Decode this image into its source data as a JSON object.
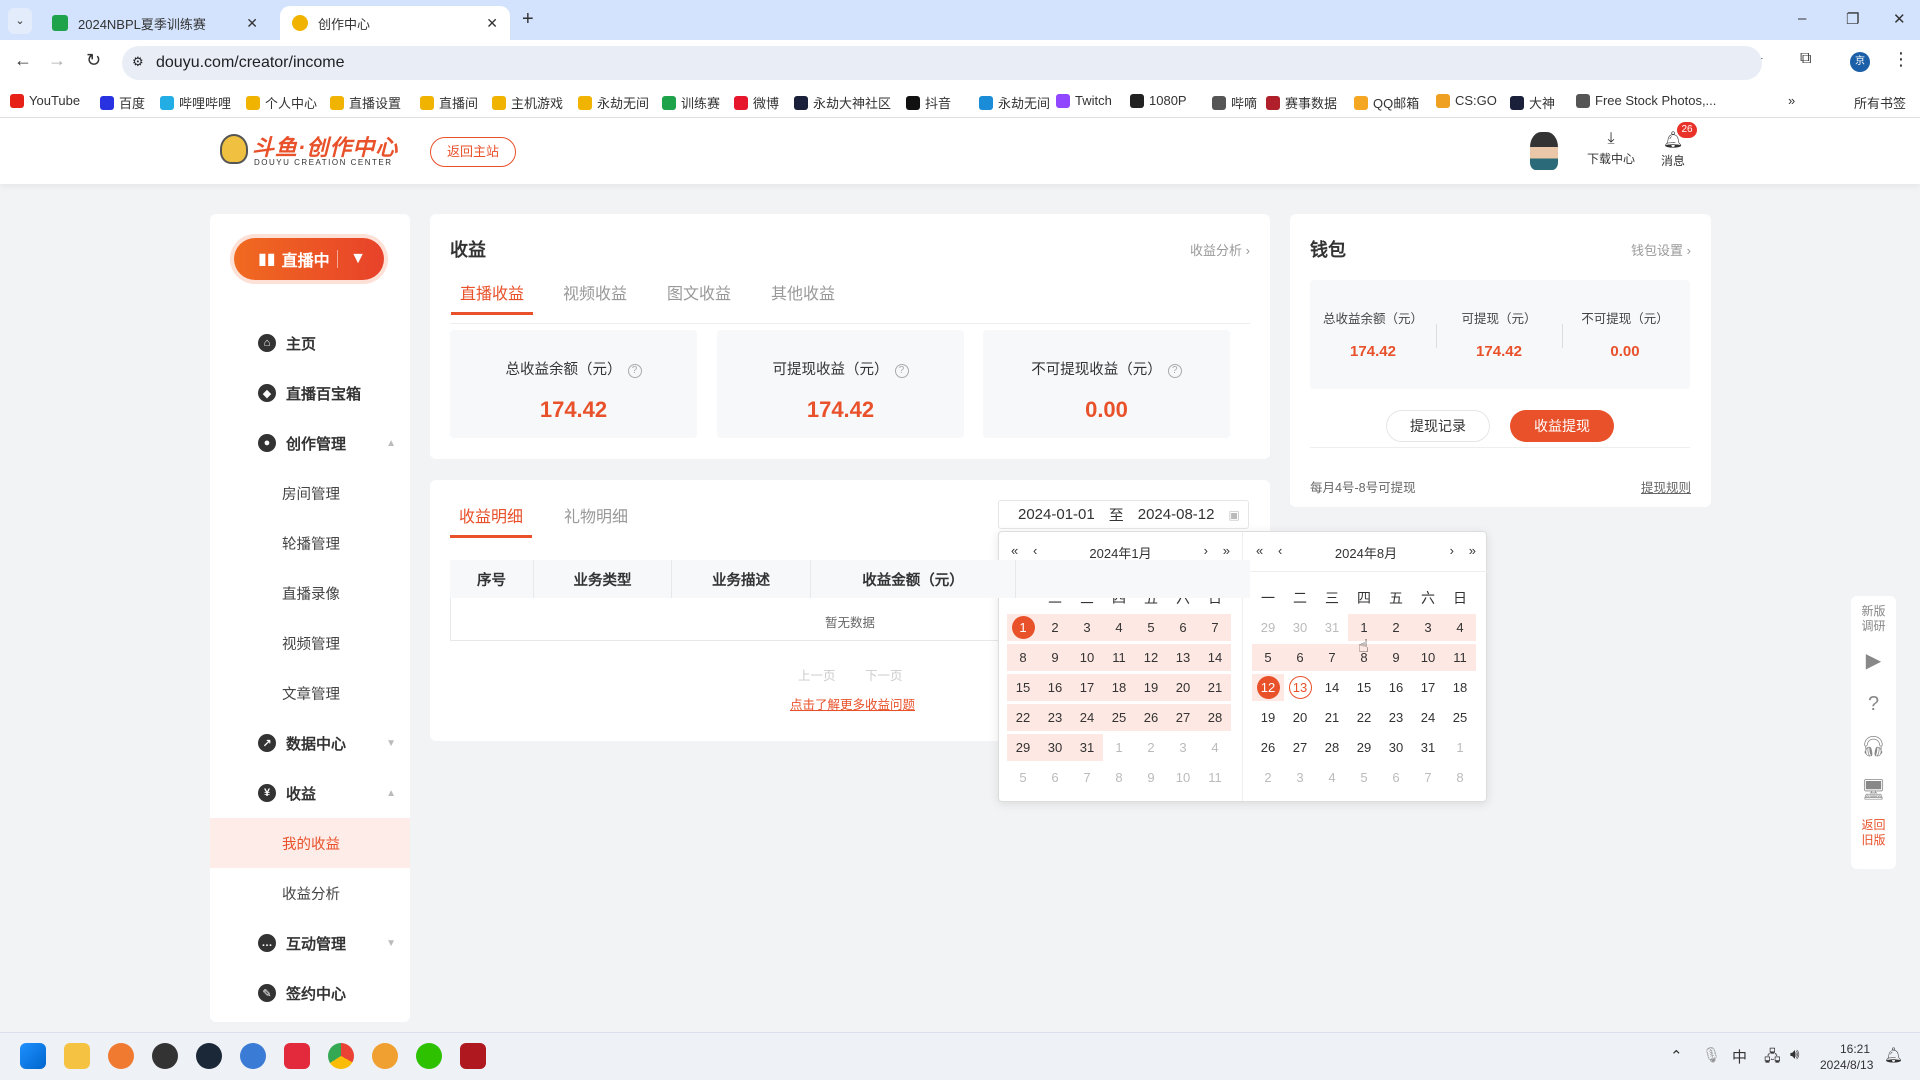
{
  "browser": {
    "tabs": [
      {
        "title": "2024NBPL夏季训练赛",
        "favicon_color": "#1fa34a",
        "active": false
      },
      {
        "title": "创作中心",
        "favicon_color": "#f0b400",
        "active": true
      }
    ],
    "new_tab": "+",
    "url": "douyu.com/creator/income",
    "bookmarks": [
      {
        "label": "YouTube",
        "color": "#e62117"
      },
      {
        "label": "百度",
        "color": "#2932e1"
      },
      {
        "label": "哔哩哔哩",
        "color": "#23ade5"
      },
      {
        "label": "个人中心",
        "color": "#f0b400"
      },
      {
        "label": "直播设置",
        "color": "#f0b400"
      },
      {
        "label": "直播间",
        "color": "#f0b400"
      },
      {
        "label": "主机游戏",
        "color": "#f0b400"
      },
      {
        "label": "永劫无间",
        "color": "#f0b400"
      },
      {
        "label": "训练赛",
        "color": "#1fa34a"
      },
      {
        "label": "微博",
        "color": "#e6162d"
      },
      {
        "label": "永劫大神社区",
        "color": "#1a1f3a"
      },
      {
        "label": "抖音",
        "color": "#111"
      },
      {
        "label": "永劫无间",
        "color": "#1a8cd8"
      },
      {
        "label": "Twitch",
        "color": "#9146ff"
      },
      {
        "label": "1080P",
        "color": "#222"
      },
      {
        "label": "哔嘀",
        "color": "#555"
      },
      {
        "label": "赛事数据",
        "color": "#b0202a"
      },
      {
        "label": "QQ邮箱",
        "color": "#f5a623"
      },
      {
        "label": "CS:GO",
        "color": "#f0a020"
      },
      {
        "label": "大神",
        "color": "#1a1f3a"
      },
      {
        "label": "Free Stock Photos,...",
        "color": "#555"
      }
    ],
    "more": "»",
    "all_bookmarks": "所有书签",
    "profile_initial": "京"
  },
  "header": {
    "logo_text": "斗鱼·创作中心",
    "logo_sub": "DOUYU CREATION CENTER",
    "back_button": "返回主站",
    "download": "下载中心",
    "messages": "消息",
    "message_count": "26"
  },
  "sidebar": {
    "live_button": "直播中",
    "items": [
      {
        "label": "主页",
        "type": "main",
        "icon": "home-icon"
      },
      {
        "label": "直播百宝箱",
        "type": "main",
        "icon": "box-icon"
      },
      {
        "label": "创作管理",
        "type": "main",
        "icon": "bulb-icon",
        "caret": "up"
      },
      {
        "label": "房间管理",
        "type": "sub"
      },
      {
        "label": "轮播管理",
        "type": "sub"
      },
      {
        "label": "直播录像",
        "type": "sub"
      },
      {
        "label": "视频管理",
        "type": "sub"
      },
      {
        "label": "文章管理",
        "type": "sub"
      },
      {
        "label": "数据中心",
        "type": "main",
        "icon": "chart-icon",
        "caret": "down"
      },
      {
        "label": "收益",
        "type": "main",
        "icon": "yuan-icon",
        "caret": "up"
      },
      {
        "label": "我的收益",
        "type": "sub",
        "active": true
      },
      {
        "label": "收益分析",
        "type": "sub"
      },
      {
        "label": "互动管理",
        "type": "main",
        "icon": "chat-icon",
        "caret": "down"
      },
      {
        "label": "签约中心",
        "type": "main",
        "icon": "sign-icon"
      }
    ]
  },
  "income": {
    "title": "收益",
    "analysis_link": "收益分析",
    "tabs": [
      "直播收益",
      "视频收益",
      "图文收益",
      "其他收益"
    ],
    "active_tab": 0,
    "stats": [
      {
        "label": "总收益余额（元）",
        "value": "174.42"
      },
      {
        "label": "可提现收益（元）",
        "value": "174.42"
      },
      {
        "label": "不可提现收益（元）",
        "value": "0.00"
      }
    ]
  },
  "wallet": {
    "title": "钱包",
    "settings_link": "钱包设置",
    "stats": [
      {
        "label": "总收益余额（元）",
        "value": "174.42"
      },
      {
        "label": "可提现（元）",
        "value": "174.42"
      },
      {
        "label": "不可提现（元）",
        "value": "0.00"
      }
    ],
    "record_button": "提现记录",
    "withdraw_button": "收益提现",
    "note": "每月4号-8号可提现",
    "rules_link": "提现规则"
  },
  "details": {
    "tabs": [
      "收益明细",
      "礼物明细"
    ],
    "active_tab": 0,
    "date_start": "2024-01-01",
    "date_sep": "至",
    "date_end": "2024-08-12",
    "columns": [
      "序号",
      "业务类型",
      "业务描述",
      "收益金额（元）"
    ],
    "empty": "暂无数据",
    "prev": "上一页",
    "next": "下一页",
    "help_link": "点击了解更多收益问题"
  },
  "calendar": {
    "weekdays": [
      "一",
      "二",
      "三",
      "四",
      "五",
      "六",
      "日"
    ],
    "panels": [
      {
        "title": "2024年1月",
        "days": [
          [
            1,
            "sel"
          ],
          [
            2,
            "range"
          ],
          [
            3,
            "range"
          ],
          [
            4,
            "range"
          ],
          [
            5,
            "range"
          ],
          [
            6,
            "range"
          ],
          [
            7,
            "range"
          ],
          [
            8,
            "range"
          ],
          [
            9,
            "range"
          ],
          [
            10,
            "range"
          ],
          [
            11,
            "range"
          ],
          [
            12,
            "range"
          ],
          [
            13,
            "range"
          ],
          [
            14,
            "range"
          ],
          [
            15,
            "range"
          ],
          [
            16,
            "range"
          ],
          [
            17,
            "range"
          ],
          [
            18,
            "range"
          ],
          [
            19,
            "range"
          ],
          [
            20,
            "range"
          ],
          [
            21,
            "range"
          ],
          [
            22,
            "range"
          ],
          [
            23,
            "range"
          ],
          [
            24,
            "range"
          ],
          [
            25,
            "range"
          ],
          [
            26,
            "range"
          ],
          [
            27,
            "range"
          ],
          [
            28,
            "range"
          ],
          [
            29,
            "range"
          ],
          [
            30,
            "range"
          ],
          [
            31,
            "range"
          ],
          [
            1,
            "other"
          ],
          [
            2,
            "other"
          ],
          [
            3,
            "other"
          ],
          [
            4,
            "other"
          ],
          [
            5,
            "other"
          ],
          [
            6,
            "other"
          ],
          [
            7,
            "other"
          ],
          [
            8,
            "other"
          ],
          [
            9,
            "other"
          ],
          [
            10,
            "other"
          ],
          [
            11,
            "other"
          ]
        ]
      },
      {
        "title": "2024年8月",
        "days": [
          [
            29,
            "other"
          ],
          [
            30,
            "other"
          ],
          [
            31,
            "other"
          ],
          [
            1,
            "range"
          ],
          [
            2,
            "range"
          ],
          [
            3,
            "range"
          ],
          [
            4,
            "range"
          ],
          [
            5,
            "range"
          ],
          [
            6,
            "range"
          ],
          [
            7,
            "range"
          ],
          [
            8,
            "range"
          ],
          [
            9,
            "range"
          ],
          [
            10,
            "range"
          ],
          [
            11,
            "range"
          ],
          [
            12,
            "sel"
          ],
          [
            13,
            "today"
          ],
          [
            14,
            ""
          ],
          [
            15,
            ""
          ],
          [
            16,
            ""
          ],
          [
            17,
            ""
          ],
          [
            18,
            ""
          ],
          [
            19,
            ""
          ],
          [
            20,
            ""
          ],
          [
            21,
            ""
          ],
          [
            22,
            ""
          ],
          [
            23,
            ""
          ],
          [
            24,
            ""
          ],
          [
            25,
            ""
          ],
          [
            26,
            ""
          ],
          [
            27,
            ""
          ],
          [
            28,
            ""
          ],
          [
            29,
            ""
          ],
          [
            30,
            ""
          ],
          [
            31,
            ""
          ],
          [
            1,
            "other"
          ],
          [
            2,
            "other"
          ],
          [
            3,
            "other"
          ],
          [
            4,
            "other"
          ],
          [
            5,
            "other"
          ],
          [
            6,
            "other"
          ],
          [
            7,
            "other"
          ],
          [
            8,
            "other"
          ]
        ]
      }
    ]
  },
  "floatbar": {
    "survey": "新版调研",
    "old_version": "返回旧版"
  },
  "taskbar": {
    "time": "16:21",
    "date": "2024/8/13",
    "ime": "中"
  },
  "colors": {
    "accent": "#e8512a",
    "range": "#fde8e3"
  }
}
